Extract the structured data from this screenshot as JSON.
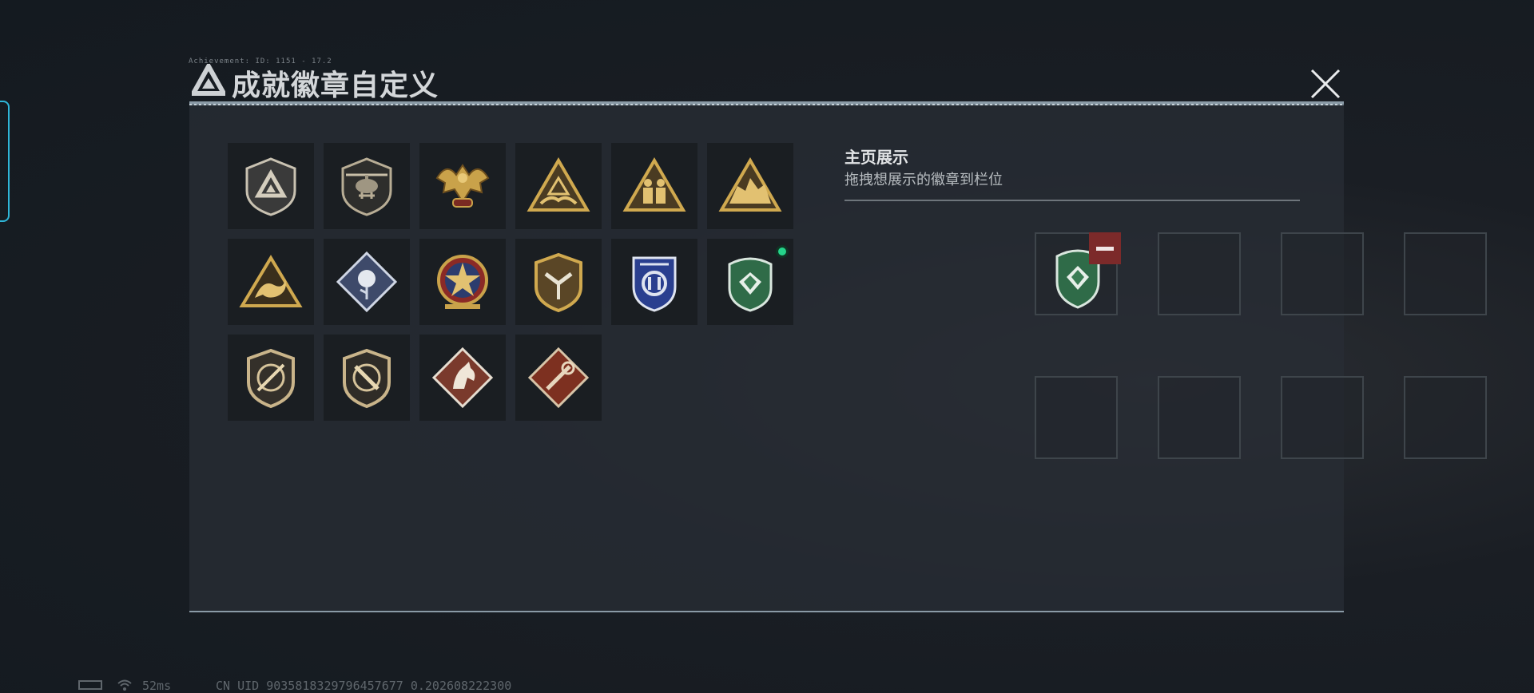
{
  "window": {
    "caption": "Achievement: ID: 1151 - 17.2",
    "title": "成就徽章自定义"
  },
  "collection": {
    "badges": [
      {
        "name": "recruit-shield-badge",
        "owned": true
      },
      {
        "name": "helicopter-shield-badge",
        "owned": true
      },
      {
        "name": "golden-eagle-badge",
        "owned": true
      },
      {
        "name": "gold-triangle-hands-badge",
        "owned": true
      },
      {
        "name": "gold-triangle-soldiers-badge",
        "owned": true
      },
      {
        "name": "gold-triangle-beast-badge",
        "owned": true
      },
      {
        "name": "gold-triangle-dragon-badge",
        "owned": true
      },
      {
        "name": "silver-rose-diamond-badge",
        "owned": true
      },
      {
        "name": "red-star-medal-badge",
        "owned": true
      },
      {
        "name": "gold-chevron-shield-badge",
        "owned": true
      },
      {
        "name": "blue-wing-shield-badge",
        "owned": true
      },
      {
        "name": "green-diamond-shield-badge",
        "owned": true,
        "active": true
      },
      {
        "name": "gold-knife-shield-badge",
        "owned": true
      },
      {
        "name": "gold-knife-shield-2-badge",
        "owned": true
      },
      {
        "name": "horse-diamond-badge",
        "owned": true
      },
      {
        "name": "red-tool-diamond-badge",
        "owned": true
      }
    ]
  },
  "showcase": {
    "title": "主页展示",
    "subtitle": "拖拽想展示的徽章到栏位",
    "slots": [
      {
        "filled": true,
        "badge": "green-diamond-shield-badge"
      },
      {
        "filled": false
      },
      {
        "filled": false
      },
      {
        "filled": false
      },
      {
        "filled": false
      },
      {
        "filled": false
      },
      {
        "filled": false
      },
      {
        "filled": false
      }
    ]
  },
  "status": {
    "latency": "52ms",
    "uid": "CN UID 9035818329796457677 0.202608222300"
  },
  "colors": {
    "accent": "#2fb6d8",
    "remove": "#7c2a2a",
    "active": "#25d38a",
    "gold": "#c9a24a"
  }
}
